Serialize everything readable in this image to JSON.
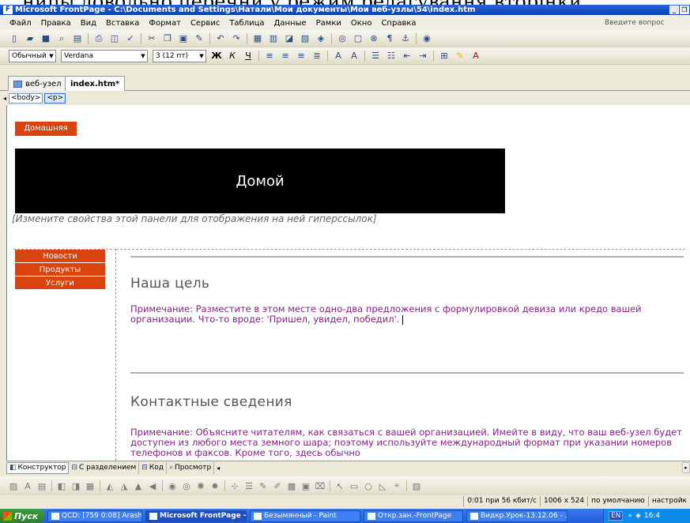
{
  "caption_text": "ницы довольно перечни у режим редагування вторінки",
  "window": {
    "title": "Microsoft FrontPage - C:\\Documents and Settings\\Натали\\Мои документы\\Мои веб-узлы\\54\\index.htm",
    "min": "_",
    "restore": "❐"
  },
  "menu": {
    "items": [
      "Файл",
      "Правка",
      "Вид",
      "Вставка",
      "Формат",
      "Сервис",
      "Таблица",
      "Данные",
      "Рамки",
      "Окно",
      "Справка"
    ],
    "help_placeholder": "Введите вопрос"
  },
  "format_bar": {
    "style": "Обычный",
    "font": "Verdana",
    "size": "3 (12 пт)"
  },
  "tabs": [
    {
      "label": "веб-узел"
    },
    {
      "label": "index.htm*"
    }
  ],
  "tag_selector": [
    "<body>",
    "<p>"
  ],
  "page": {
    "home_button": "Домашняя",
    "banner_text": "Домой",
    "hint": "[Измените свойства этой панели для отображения на ней гиперссылок]",
    "nav": [
      "Новости",
      "Продукты",
      "Услуги"
    ],
    "section1": {
      "heading": "Наша цель",
      "text": "Примечание: Разместите в этом месте одно-два предложения с формулировкой девиза или кредо вашей организации. Что-то вроде: 'Пришел, увидел, победил'."
    },
    "section2": {
      "heading": "Контактные сведения",
      "text": "Примечание: Объясните читателям, как связаться с вашей организацией. Имейте в виду, что ваш веб-узел будет доступен из любого места земного шара; поэтому используйте международный формат при указании номеров телефонов и факсов. Кроме того, здесь обычно"
    }
  },
  "view_tabs": [
    "Конструктор",
    "С разделением",
    "Код",
    "Просмотр"
  ],
  "status": [
    "0:01 при 56 кбит/с",
    "1006 x 524",
    "по умолчанию",
    "настройк"
  ],
  "taskbar": {
    "start": "Пуск",
    "tasks": [
      "QCD: [759 0:08] Arash ...",
      "Microsoft FrontPage -...",
      "Безымянный - Paint",
      "Откр.зан.-FrontPage",
      "Видкр.Урок-13.12.06 - ..."
    ],
    "lang": "EN",
    "clock": "16:4"
  }
}
